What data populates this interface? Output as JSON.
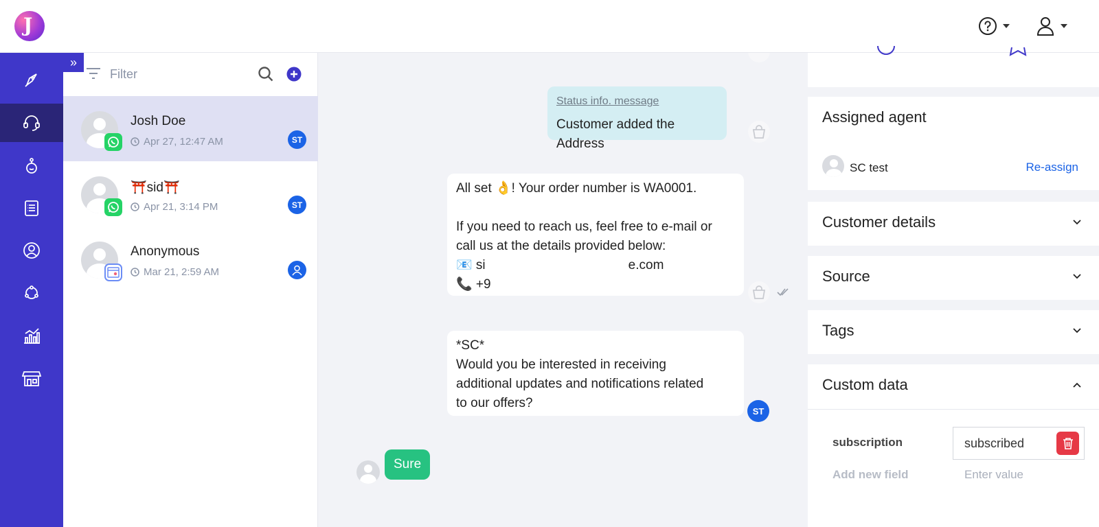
{
  "topbar": {
    "logo_letter": "J",
    "help_icon": "help-circle-icon",
    "user_icon": "user-icon"
  },
  "leftnav": {
    "items": [
      {
        "name": "campaigns",
        "icon": "rocket-icon"
      },
      {
        "name": "inbox",
        "icon": "headset-icon",
        "active": true
      },
      {
        "name": "bots",
        "icon": "bot-icon"
      },
      {
        "name": "templates",
        "icon": "clipboard-list-icon"
      },
      {
        "name": "contacts",
        "icon": "user-circle-icon"
      },
      {
        "name": "integrations",
        "icon": "network-icon"
      },
      {
        "name": "analytics",
        "icon": "bar-chart-icon"
      },
      {
        "name": "store",
        "icon": "store-icon"
      }
    ]
  },
  "convlist": {
    "filter_label": "Filter",
    "conversations": [
      {
        "name": "Josh Doe",
        "time": "Apr 27, 12:47 AM",
        "channel": "whatsapp",
        "agent": "ST",
        "active": true
      },
      {
        "name": "⛩️sid⛩️",
        "time": "Apr 21, 3:14 PM",
        "channel": "whatsapp",
        "agent": "ST"
      },
      {
        "name": "Anonymous",
        "time": "Mar 21, 2:59 AM",
        "channel": "web",
        "agent": "user"
      }
    ]
  },
  "chat": {
    "status_link": "Status info. message",
    "status_text": "Customer added the Address",
    "order_line1": "All set 👌! Your order number is WA0001.",
    "order_line2": "If you need to reach us, feel free to e-mail or",
    "order_line3": "call us at the details provided below:",
    "order_email_start": "📧 si",
    "order_email_end": "e.com",
    "order_phone": "📞 +9",
    "sc_line1": "*SC*",
    "sc_line2": "Would you be interested in receiving",
    "sc_line3": "additional updates and notifications related",
    "sc_line4": "to our offers?",
    "sc_agent": "ST",
    "reply": "Sure"
  },
  "rightpanel": {
    "assigned_agent_title": "Assigned agent",
    "agent_name": "SC test",
    "reassign_label": "Re-assign",
    "customer_details_title": "Customer details",
    "source_title": "Source",
    "tags_title": "Tags",
    "custom_data_title": "Custom data",
    "custom_field_key": "subscription",
    "custom_field_value": "subscribed",
    "add_field_placeholder": "Add new field",
    "enter_value_placeholder": "Enter value"
  },
  "colors": {
    "nav_bg": "#3f37c9",
    "nav_active": "#2a2577",
    "accent_blue": "#1b63e6",
    "reply_green": "#27c281",
    "status_bubble": "#d4eef3",
    "delete_red": "#e63946"
  }
}
